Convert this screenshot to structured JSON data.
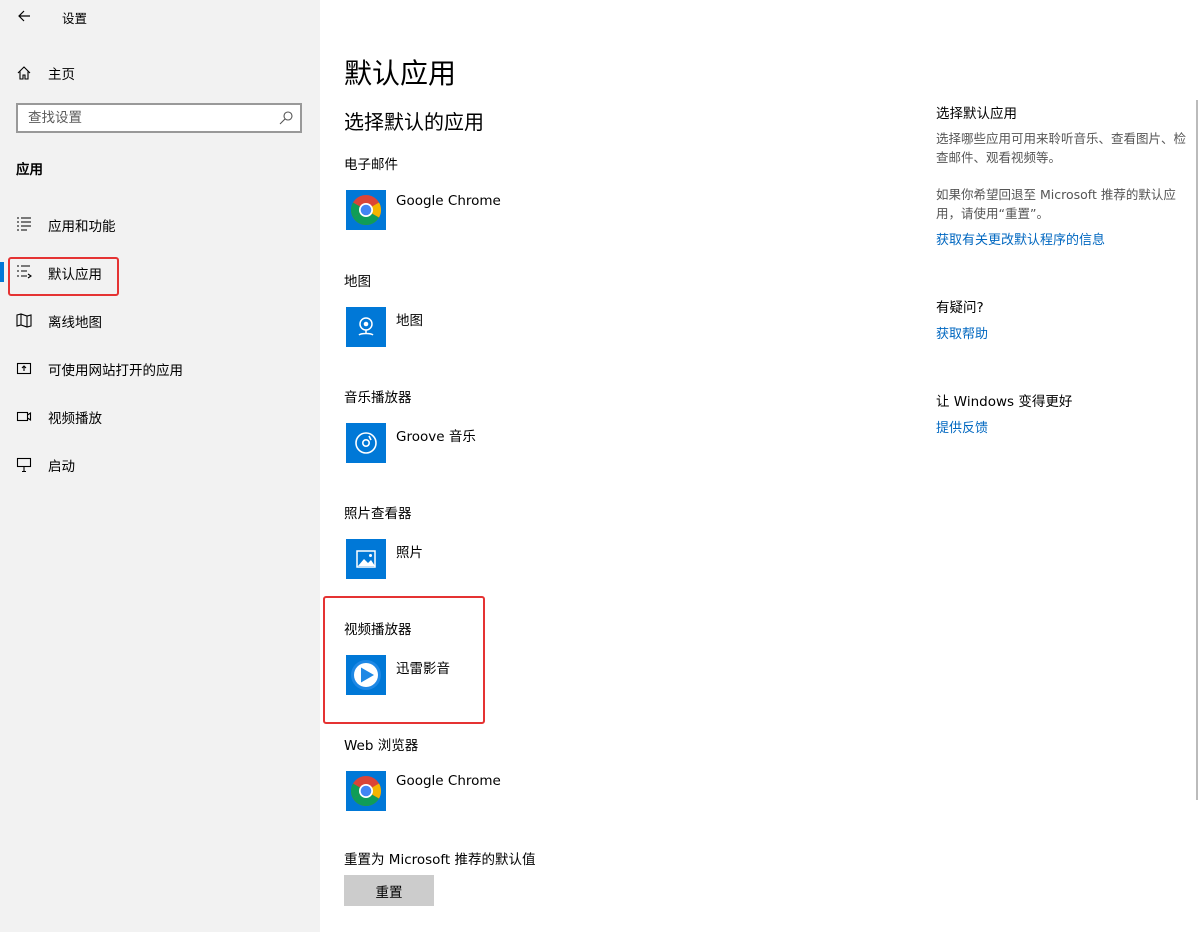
{
  "window": {
    "title": "设置",
    "controls": {
      "minimize": "minimize",
      "maximize": "maximize",
      "close": "close"
    }
  },
  "sidebar": {
    "home_label": "主页",
    "search_placeholder": "查找设置",
    "section_heading": "应用",
    "items": [
      {
        "label": "应用和功能",
        "icon": "apps-list-icon",
        "active": false
      },
      {
        "label": "默认应用",
        "icon": "default-apps-icon",
        "active": true
      },
      {
        "label": "离线地图",
        "icon": "offline-map-icon",
        "active": false
      },
      {
        "label": "可使用网站打开的应用",
        "icon": "open-with-icon",
        "active": false
      },
      {
        "label": "视频播放",
        "icon": "video-icon",
        "active": false
      },
      {
        "label": "启动",
        "icon": "startup-icon",
        "active": false
      }
    ]
  },
  "main": {
    "title": "默认应用",
    "subtitle": "选择默认的应用",
    "categories": [
      {
        "label": "电子邮件",
        "app": "Google Chrome",
        "icon": "chrome-icon"
      },
      {
        "label": "地图",
        "app": "地图",
        "icon": "maps-icon"
      },
      {
        "label": "音乐播放器",
        "app": "Groove 音乐",
        "icon": "groove-music-icon"
      },
      {
        "label": "照片查看器",
        "app": "照片",
        "icon": "photos-icon"
      },
      {
        "label": "视频播放器",
        "app": "迅雷影音",
        "icon": "xunlei-player-icon"
      },
      {
        "label": "Web 浏览器",
        "app": "Google Chrome",
        "icon": "chrome-icon"
      }
    ],
    "reset_label": "重置为 Microsoft 推荐的默认值",
    "reset_button": "重置"
  },
  "related": {
    "heading": "选择默认应用",
    "desc1": "选择哪些应用可用来聆听音乐、查看图片、检查邮件、观看视频等。",
    "desc2": "如果你希望回退至 Microsoft 推荐的默认应用，请使用“重置”。",
    "link1": "获取有关更改默认程序的信息",
    "question_heading": "有疑问?",
    "help_link": "获取帮助",
    "improve_heading": "让 Windows 变得更好",
    "feedback_link": "提供反馈"
  },
  "colors": {
    "accent": "#0078d7",
    "link": "#0067c0",
    "highlight": "#e53333",
    "sidebar_bg": "#f2f2f2"
  }
}
